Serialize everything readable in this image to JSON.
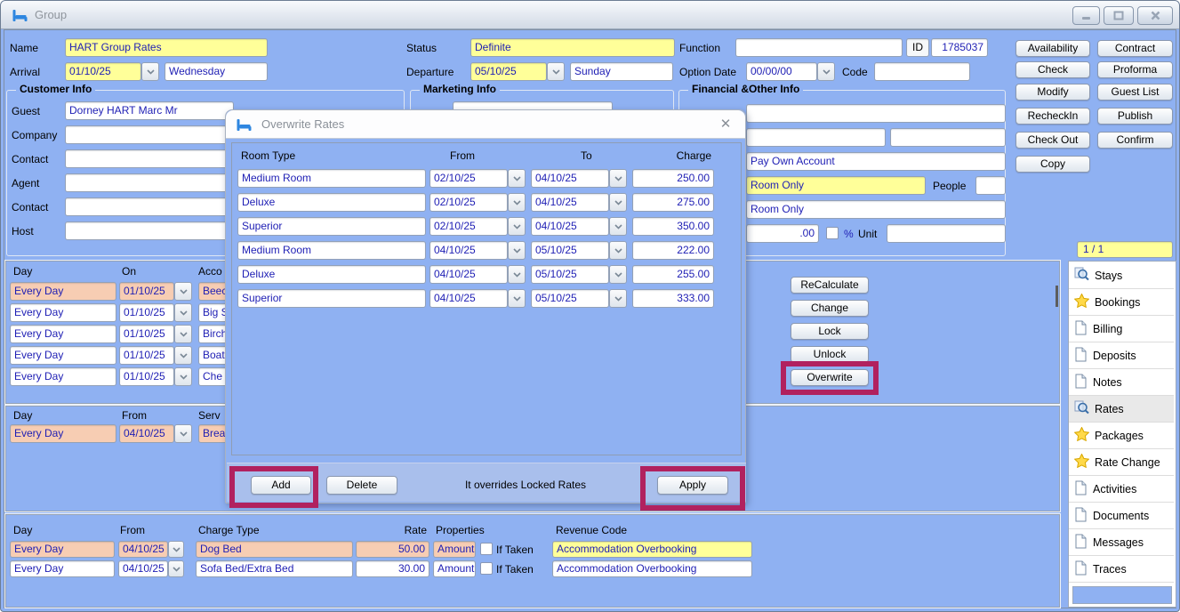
{
  "window": {
    "title": "Group"
  },
  "form": {
    "name": {
      "label": "Name",
      "value": "HART Group Rates"
    },
    "status": {
      "label": "Status",
      "value": "Definite"
    },
    "function": {
      "label": "Function",
      "value": ""
    },
    "id": {
      "label": "ID",
      "value": "1785037"
    },
    "arrival": {
      "label": "Arrival",
      "date": "01/10/25",
      "day": "Wednesday"
    },
    "departure": {
      "label": "Departure",
      "date": "05/10/25",
      "day": "Sunday"
    },
    "option_date": {
      "label": "Option Date",
      "value": "00/00/00"
    },
    "code": {
      "label": "Code",
      "value": ""
    }
  },
  "actions": [
    "Availability",
    "Contract",
    "Check",
    "Proforma",
    "Modify",
    "Guest List",
    "RecheckIn",
    "Publish",
    "Check Out",
    "Confirm",
    "Copy"
  ],
  "customer": {
    "title": "Customer Info",
    "rows": [
      {
        "label": "Guest",
        "value": "Dorney HART Marc Mr"
      },
      {
        "label": "Company",
        "value": ""
      },
      {
        "label": "Contact",
        "value": ""
      },
      {
        "label": "Agent",
        "value": ""
      },
      {
        "label": "Contact",
        "value": ""
      },
      {
        "label": "Host",
        "value": ""
      }
    ]
  },
  "marketing": {
    "title": "Marketing Info"
  },
  "financial": {
    "title": "Financial &Other Info",
    "pay_account": "Pay Own Account",
    "board": "Room Only",
    "people_label": "People",
    "board2": "Room Only",
    "amount": ".00",
    "percent": "%",
    "unit_label": "Unit"
  },
  "pager": "1 / 1",
  "accommodation_table": {
    "headers": {
      "day": "Day",
      "on": "On",
      "acc": "Acco"
    },
    "rows": [
      {
        "day": "Every Day",
        "on": "01/10/25",
        "acc": "Beec"
      },
      {
        "day": "Every Day",
        "on": "01/10/25",
        "acc": "Big S"
      },
      {
        "day": "Every Day",
        "on": "01/10/25",
        "acc": "Birch"
      },
      {
        "day": "Every Day",
        "on": "01/10/25",
        "acc": "Boat"
      },
      {
        "day": "Every Day",
        "on": "01/10/25",
        "acc": "Che"
      }
    ]
  },
  "rate_actions": [
    "ReCalculate",
    "Change",
    "Lock",
    "Unlock",
    "Overwrite"
  ],
  "services_table": {
    "headers": {
      "day": "Day",
      "from": "From",
      "service": "Serv"
    },
    "rows": [
      {
        "day": "Every Day",
        "from": "04/10/25",
        "service": "Brea"
      }
    ]
  },
  "charges_table": {
    "headers": [
      "Day",
      "From",
      "Charge Type",
      "Rate",
      "Properties",
      "Revenue Code"
    ],
    "if_taken": "If Taken",
    "rows": [
      {
        "day": "Every Day",
        "from": "04/10/25",
        "type": "Dog Bed",
        "rate": "50.00",
        "prop": "Amount",
        "revenue": "Accommodation Overbooking"
      },
      {
        "day": "Every Day",
        "from": "04/10/25",
        "type": "Sofa Bed/Extra Bed",
        "rate": "30.00",
        "prop": "Amount",
        "revenue": "Accommodation Overbooking"
      }
    ]
  },
  "dialog": {
    "title": "Overwrite Rates",
    "close": "✕",
    "headers": [
      "Room Type",
      "From",
      "To",
      "Charge"
    ],
    "rows": [
      [
        "Medium Room",
        "02/10/25",
        "04/10/25",
        "250.00"
      ],
      [
        "Deluxe",
        "02/10/25",
        "04/10/25",
        "275.00"
      ],
      [
        "Superior",
        "02/10/25",
        "04/10/25",
        "350.00"
      ],
      [
        "Medium Room",
        "04/10/25",
        "05/10/25",
        "222.00"
      ],
      [
        "Deluxe",
        "04/10/25",
        "05/10/25",
        "255.00"
      ],
      [
        "Superior",
        "04/10/25",
        "05/10/25",
        "333.00"
      ]
    ],
    "add": "Add",
    "delete": "Delete",
    "note": "It overrides Locked Rates",
    "apply": "Apply"
  },
  "sidebar": {
    "items": [
      {
        "label": "Stays",
        "icon": "magnifier"
      },
      {
        "label": "Bookings",
        "icon": "star"
      },
      {
        "label": "Billing",
        "icon": "document"
      },
      {
        "label": "Deposits",
        "icon": "document"
      },
      {
        "label": "Notes",
        "icon": "document"
      },
      {
        "label": "Rates",
        "icon": "magnifier",
        "active": true
      },
      {
        "label": "Packages",
        "icon": "star"
      },
      {
        "label": "Rate Change",
        "icon": "star"
      },
      {
        "label": "Activities",
        "icon": "document"
      },
      {
        "label": "Documents",
        "icon": "document"
      },
      {
        "label": "Messages",
        "icon": "document"
      },
      {
        "label": "Traces",
        "icon": "document"
      }
    ]
  },
  "colors": {
    "background": "#8FB1F2",
    "highlight": "#B1215F",
    "selected_row": "#F7CDB3",
    "field_yellow": "#FFFF99"
  }
}
